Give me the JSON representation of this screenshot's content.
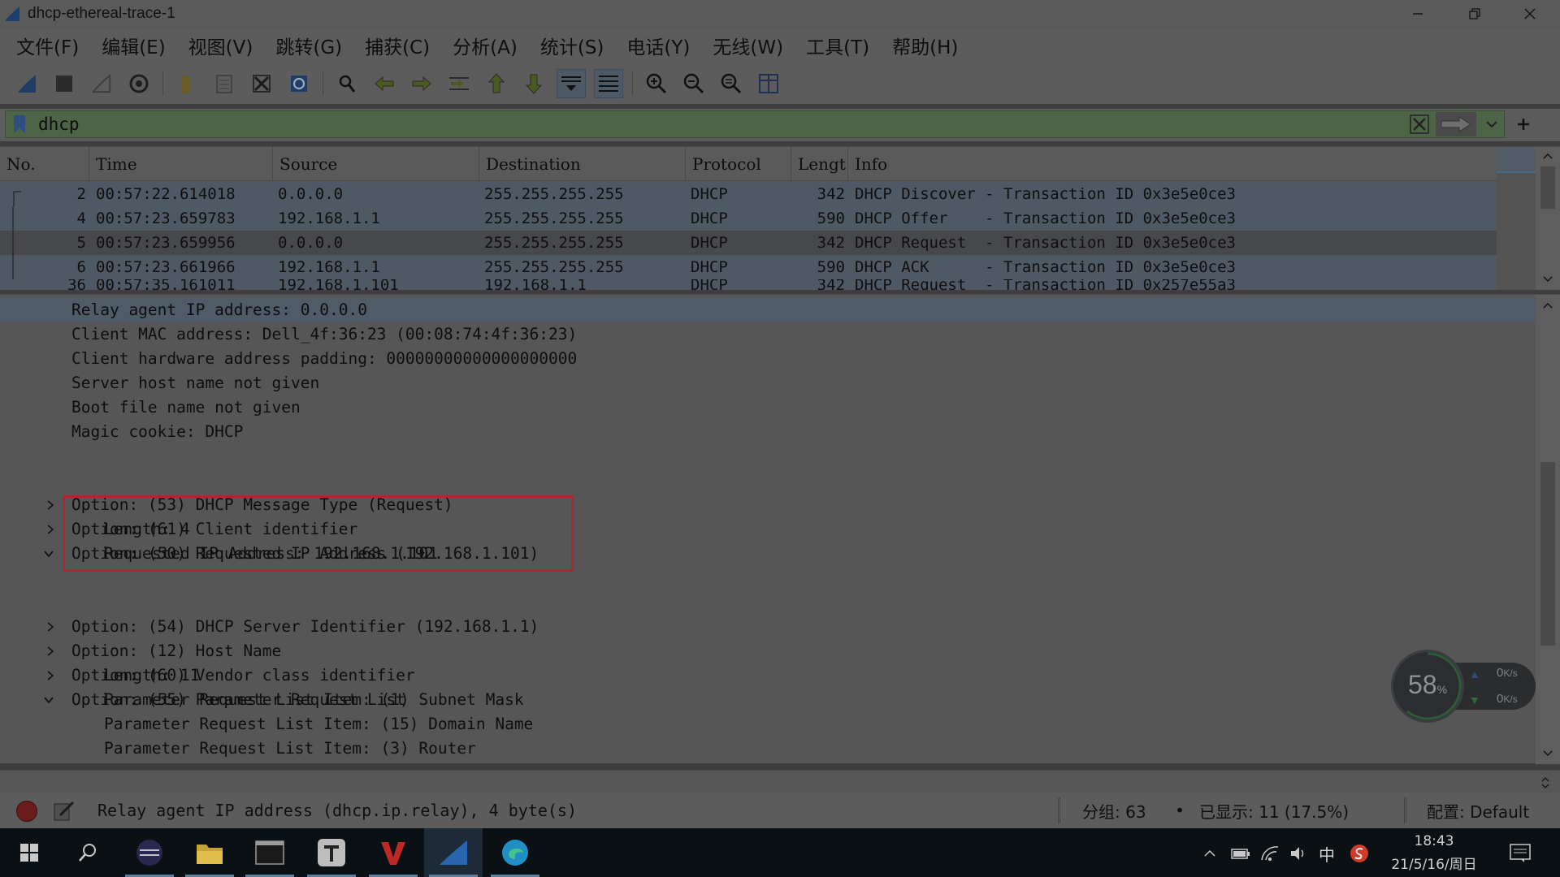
{
  "window": {
    "title": "dhcp-ethereal-trace-1"
  },
  "menu": [
    "文件(F)",
    "编辑(E)",
    "视图(V)",
    "跳转(G)",
    "捕获(C)",
    "分析(A)",
    "统计(S)",
    "电话(Y)",
    "无线(W)",
    "工具(T)",
    "帮助(H)"
  ],
  "filter": {
    "value": "dhcp"
  },
  "packet_list": {
    "columns": [
      "No.",
      "Time",
      "Source",
      "Destination",
      "Protocol",
      "Lengt",
      "Info"
    ],
    "rows": [
      {
        "no": "2",
        "time": "00:57:22.614018",
        "source": "0.0.0.0",
        "destination": "255.255.255.255",
        "protocol": "DHCP",
        "length": "342",
        "info": "DHCP Discover - Transaction ID 0x3e5e0ce3"
      },
      {
        "no": "4",
        "time": "00:57:23.659783",
        "source": "192.168.1.1",
        "destination": "255.255.255.255",
        "protocol": "DHCP",
        "length": "590",
        "info": "DHCP Offer    - Transaction ID 0x3e5e0ce3"
      },
      {
        "no": "5",
        "time": "00:57:23.659956",
        "source": "0.0.0.0",
        "destination": "255.255.255.255",
        "protocol": "DHCP",
        "length": "342",
        "info": "DHCP Request  - Transaction ID 0x3e5e0ce3"
      },
      {
        "no": "6",
        "time": "00:57:23.661966",
        "source": "192.168.1.1",
        "destination": "255.255.255.255",
        "protocol": "DHCP",
        "length": "590",
        "info": "DHCP ACK      - Transaction ID 0x3e5e0ce3"
      },
      {
        "no": "36",
        "time": "00:57:35.161011",
        "source": "192.168.1.101",
        "destination": "192.168.1.1",
        "protocol": "DHCP",
        "length": "342",
        "info": "DHCP Request  - Transaction ID 0x257e55a3"
      }
    ]
  },
  "details": {
    "lines": [
      {
        "text": "Relay agent IP address: 0.0.0.0",
        "arrow": "none"
      },
      {
        "text": "Client MAC address: Dell_4f:36:23 (00:08:74:4f:36:23)",
        "arrow": "none"
      },
      {
        "text": "Client hardware address padding: 00000000000000000000",
        "arrow": "none"
      },
      {
        "text": "Server host name not given",
        "arrow": "none"
      },
      {
        "text": "Boot file name not given",
        "arrow": "none"
      },
      {
        "text": "Magic cookie: DHCP",
        "arrow": "none"
      },
      {
        "text": "Option: (53) DHCP Message Type (Request)",
        "arrow": "collapsed"
      },
      {
        "text": "Option: (61) Client identifier",
        "arrow": "collapsed"
      },
      {
        "text": "Option: (50) Requested IP Address (192.168.1.101)",
        "arrow": "expanded"
      },
      {
        "text": "Length: 4",
        "arrow": "none"
      },
      {
        "text": "Requested IP Address: 192.168.1.101",
        "arrow": "none"
      },
      {
        "text": "Option: (54) DHCP Server Identifier (192.168.1.1)",
        "arrow": "collapsed"
      },
      {
        "text": "Option: (12) Host Name",
        "arrow": "collapsed"
      },
      {
        "text": "Option: (60) Vendor class identifier",
        "arrow": "collapsed"
      },
      {
        "text": "Option: (55) Parameter Request List",
        "arrow": "expanded"
      },
      {
        "text": "Length: 11",
        "arrow": "none"
      },
      {
        "text": "Parameter Request List Item: (1) Subnet Mask",
        "arrow": "none"
      },
      {
        "text": "Parameter Request List Item: (15) Domain Name",
        "arrow": "none"
      },
      {
        "text": "Parameter Request List Item: (3) Router",
        "arrow": "none"
      }
    ]
  },
  "status": {
    "field_text": "Relay agent IP address (dhcp.ip.relay), 4 byte(s)",
    "packets": "分组: 63",
    "bullet": "•",
    "displayed": "已显示: 11 (17.5%)",
    "profile": "配置: Default"
  },
  "net_widget": {
    "percent": "58",
    "percent_unit": "%",
    "up": "0",
    "down": "0",
    "rate_unit": "K/s"
  },
  "taskbar": {
    "time": "18:43",
    "date": "21/5/16/周日",
    "ime": "中"
  },
  "colors": {
    "highlight_box": "#b0252e",
    "selected_row": "#46484c",
    "filter_bg": "#4d6446"
  }
}
